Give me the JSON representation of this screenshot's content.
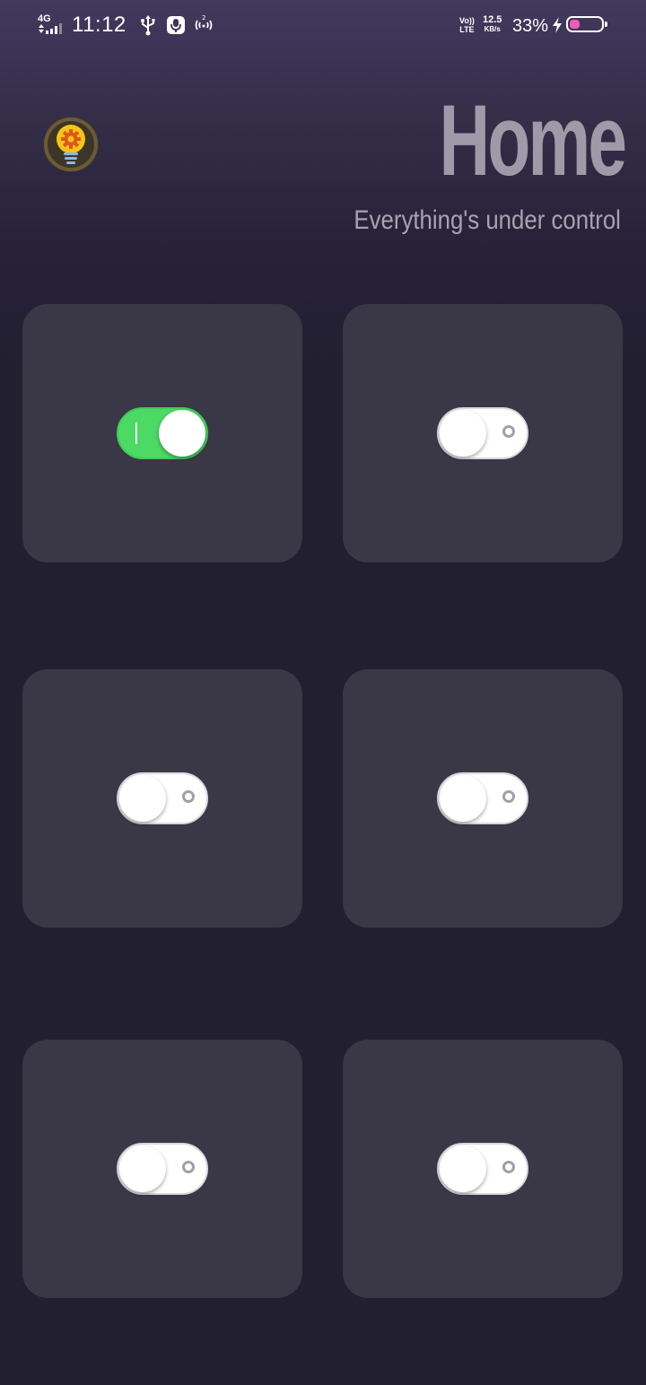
{
  "status_bar": {
    "network": "4G",
    "time": "11:12",
    "volte_top": "Vo))",
    "volte_bottom": "LTE",
    "speed_value": "12.5",
    "speed_unit": "KB/s",
    "battery_percent": "33%",
    "battery_level": 0.33,
    "battery_color": "#f25bb8",
    "icons": [
      "signal-icon",
      "usb-icon",
      "microphone-icon",
      "hotspot-icon",
      "charging-bolt-icon",
      "battery-icon"
    ]
  },
  "header": {
    "title": "Home",
    "subtitle": "Everything's under control",
    "logo_icon": "lightbulb-gear-icon"
  },
  "switches": [
    {
      "id": "switch-1",
      "state": "on"
    },
    {
      "id": "switch-2",
      "state": "off"
    },
    {
      "id": "switch-3",
      "state": "off"
    },
    {
      "id": "switch-4",
      "state": "off"
    },
    {
      "id": "switch-5",
      "state": "off"
    },
    {
      "id": "switch-6",
      "state": "off"
    }
  ],
  "colors": {
    "switch_on": "#4cd964",
    "card_background": "#3a3847",
    "page_background": "#221f30",
    "title": "#9e9aa8"
  }
}
